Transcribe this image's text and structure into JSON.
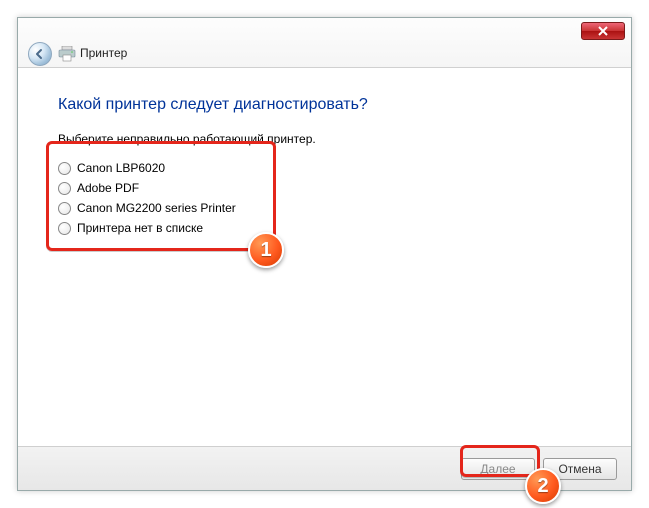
{
  "window": {
    "title": "Принтер"
  },
  "heading": "Какой принтер следует диагностировать?",
  "instruction": "Выберите неправильно работающий принтер.",
  "printers": [
    {
      "label": "Canon LBP6020"
    },
    {
      "label": "Adobe PDF"
    },
    {
      "label": "Canon MG2200 series Printer"
    },
    {
      "label": "Принтера нет в списке"
    }
  ],
  "buttons": {
    "next": "Далее",
    "cancel": "Отмена"
  },
  "annotations": {
    "badge1": "1",
    "badge2": "2"
  }
}
